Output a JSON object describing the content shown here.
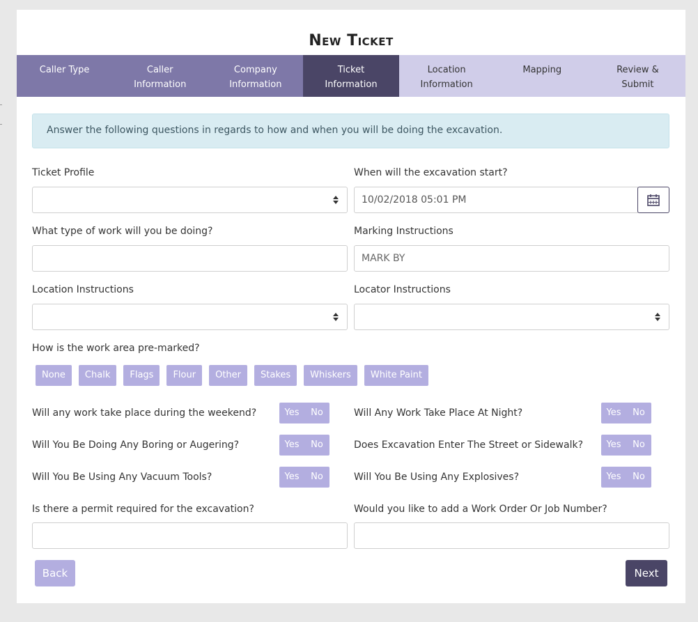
{
  "title": "New Ticket",
  "steps": [
    {
      "line1": "Caller Type",
      "line2": ""
    },
    {
      "line1": "Caller",
      "line2": "Information"
    },
    {
      "line1": "Company",
      "line2": "Information"
    },
    {
      "line1": "Ticket",
      "line2": "Information"
    },
    {
      "line1": "Location",
      "line2": "Information"
    },
    {
      "line1": "Mapping",
      "line2": ""
    },
    {
      "line1": "Review &",
      "line2": "Submit"
    }
  ],
  "alert": "Answer the following questions in regards to how and when you will be doing the excavation.",
  "fields": {
    "ticket_profile": {
      "label": "Ticket Profile",
      "value": ""
    },
    "excavation_start": {
      "label": "When will the excavation start?",
      "value": "10/02/2018 05:01 PM"
    },
    "work_type": {
      "label": "What type of work will you be doing?",
      "value": ""
    },
    "marking_instructions": {
      "label": "Marking Instructions",
      "value": "MARK BY"
    },
    "location_instructions": {
      "label": "Location Instructions",
      "value": ""
    },
    "locator_instructions": {
      "label": "Locator Instructions",
      "value": ""
    },
    "permit": {
      "label": "Is there a permit required for the excavation?",
      "value": ""
    },
    "work_order": {
      "label": "Would you like to add a Work Order Or Job Number?",
      "value": ""
    }
  },
  "premark": {
    "label": "How is the work area pre-marked?",
    "options": [
      "None",
      "Chalk",
      "Flags",
      "Flour",
      "Other",
      "Stakes",
      "Whiskers",
      "White Paint"
    ]
  },
  "questions": {
    "weekend": "Will any work take place during the weekend?",
    "night": "Will Any Work Take Place At Night?",
    "boring": "Will You Be Doing Any Boring or Augering?",
    "street": "Does Excavation Enter The Street or Sidewalk?",
    "vacuum": "Will You Be Using Any Vacuum Tools?",
    "explosives": "Will You Be Using Any Explosives?"
  },
  "yes_label": "Yes",
  "no_label": "No",
  "buttons": {
    "back": "Back",
    "next": "Next"
  }
}
